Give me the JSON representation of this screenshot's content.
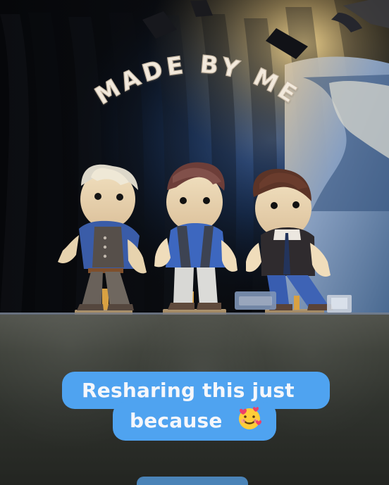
{
  "overlay": {
    "title": "MADE BY ME",
    "caption_line_1": "Resharing this just",
    "caption_line_2": "because"
  },
  "colors": {
    "caption_bubble": "#4fa3f0",
    "caption_text": "#f6f7fb",
    "background": "#06080b"
  },
  "emoji": {
    "name": "smiling-face-with-hearts"
  }
}
